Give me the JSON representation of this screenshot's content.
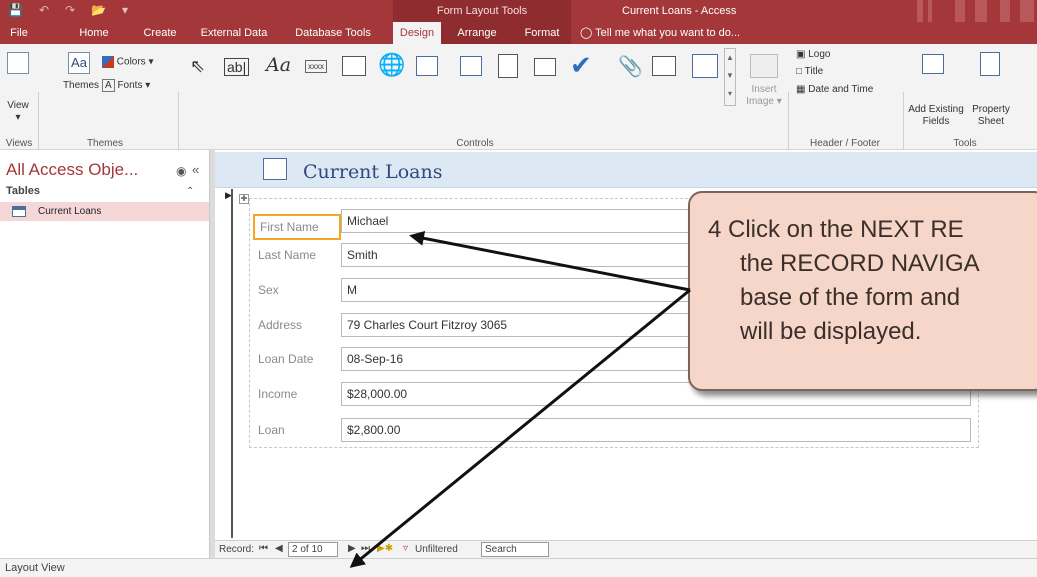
{
  "titlebar": {
    "context_group": "Form Layout Tools",
    "app_title": "Current Loans - Access"
  },
  "tabs": {
    "file": "File",
    "home": "Home",
    "create": "Create",
    "external_data": "External Data",
    "database_tools": "Database Tools",
    "design": "Design",
    "arrange": "Arrange",
    "format": "Format",
    "tell_me": "Tell me what you want to do..."
  },
  "ribbon": {
    "view": "View",
    "themes": "Themes",
    "colors": "Colors",
    "fonts": "Fonts",
    "aa": "Aa",
    "ab": "ab|",
    "xxxx": "xxxx",
    "insert": "Insert",
    "image": "Image",
    "logo": "Logo",
    "title": "Title",
    "date_time": "Date and Time",
    "add_existing": "Add Existing",
    "fields": "Fields",
    "property": "Property",
    "sheet": "Sheet",
    "groups": {
      "views": "Views",
      "themes": "Themes",
      "controls": "Controls",
      "header_footer": "Header / Footer",
      "tools": "Tools"
    }
  },
  "nav_pane": {
    "title": "All Access Obje...",
    "section": "Tables",
    "item": "Current Loans"
  },
  "form": {
    "title": "Current Loans",
    "fields": [
      {
        "label": "First Name",
        "value": "Michael"
      },
      {
        "label": "Last Name",
        "value": "Smith"
      },
      {
        "label": "Sex",
        "value": "M"
      },
      {
        "label": "Address",
        "value": "79 Charles Court Fitzroy 3065"
      },
      {
        "label": "Loan Date",
        "value": "08-Sep-16"
      },
      {
        "label": "Income",
        "value": "$28,000.00"
      },
      {
        "label": "Loan",
        "value": "$2,800.00"
      }
    ]
  },
  "record_nav": {
    "label": "Record:",
    "current": "2 of 10",
    "filter": "Unfiltered",
    "search": "Search"
  },
  "status": "Layout View",
  "callout": {
    "lines": [
      "4  Click on the NEXT RE",
      "the RECORD NAVIGA",
      "base of the form and",
      "will be displayed."
    ]
  },
  "colors": {
    "accent": "#a4373a",
    "callout_fill": "#f5d6c9",
    "focus_border": "#f5a623"
  }
}
